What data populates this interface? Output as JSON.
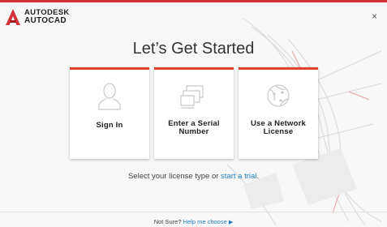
{
  "brand": {
    "line1": "AUTODESK",
    "line2": "AUTOCAD"
  },
  "window": {
    "close_glyph": "×"
  },
  "title": "Let’s Get Started",
  "cards": [
    {
      "label": "Sign In",
      "icon": "user-icon"
    },
    {
      "label": "Enter a Serial Number",
      "icon": "devices-icon"
    },
    {
      "label": "Use a Network License",
      "icon": "network-globe-icon"
    }
  ],
  "subtitle": {
    "prefix": "Select your license type or ",
    "link": "start a trial",
    "suffix": "."
  },
  "footer": {
    "prefix": "Not Sure? ",
    "link": "Help me choose",
    "arrow": "▶"
  },
  "colors": {
    "accent": "#e0412d",
    "link": "#1f7fc2",
    "brand_red": "#d13438"
  }
}
